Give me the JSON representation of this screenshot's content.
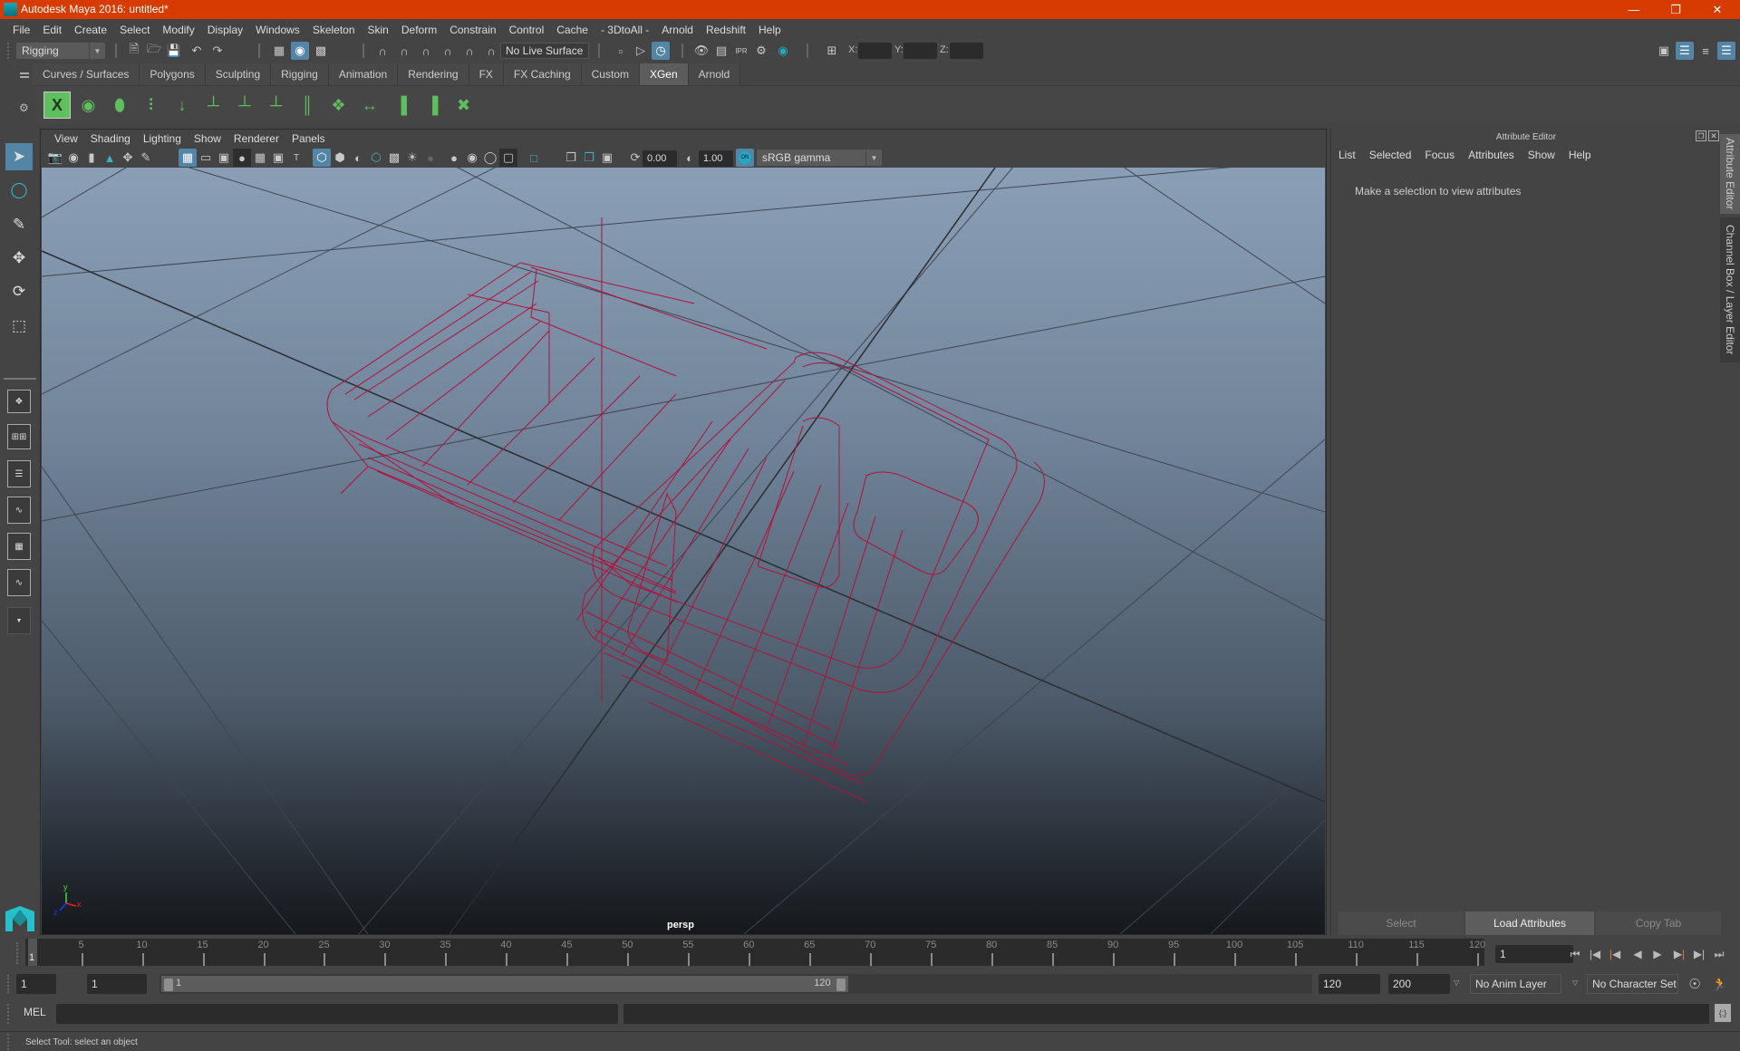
{
  "window": {
    "title": "Autodesk Maya 2016: untitled*",
    "controls": [
      "minimize",
      "restore",
      "close"
    ]
  },
  "menubar": [
    "File",
    "Edit",
    "Create",
    "Select",
    "Modify",
    "Display",
    "Windows",
    "Skeleton",
    "Skin",
    "Deform",
    "Constrain",
    "Control",
    "Cache",
    "- 3DtoAll -",
    "Arnold",
    "Redshift",
    "Help"
  ],
  "statusline": {
    "menu_set": "Rigging",
    "live_surface": "No Live Surface",
    "x_label": "X:",
    "y_label": "Y:",
    "z_label": "Z:",
    "x_value": "",
    "y_value": "",
    "z_value": ""
  },
  "shelf": {
    "tabs": [
      "Curves / Surfaces",
      "Polygons",
      "Sculpting",
      "Rigging",
      "Animation",
      "Rendering",
      "FX",
      "FX Caching",
      "Custom",
      "XGen",
      "Arnold"
    ],
    "active_tab": "XGen",
    "icons": [
      "xgen-editor",
      "preview-toggle",
      "create-description",
      "add-guides",
      "place-guides",
      "add-guide",
      "sculpt-guide",
      "lock-guide",
      "guide-curves",
      "create-patches",
      "rebuild-guides",
      "select-guides",
      "guide-bounds",
      "delete-guides"
    ]
  },
  "viewport": {
    "menu": [
      "View",
      "Shading",
      "Lighting",
      "Show",
      "Renderer",
      "Panels"
    ],
    "exposure": "0.00",
    "gamma": "1.00",
    "color_management": "ON",
    "view_transform": "sRGB gamma",
    "camera": "persp",
    "axis_labels": {
      "x": "x",
      "y": "y",
      "z": "z"
    }
  },
  "attribute_editor": {
    "title": "Attribute Editor",
    "menu": [
      "List",
      "Selected",
      "Focus",
      "Attributes",
      "Show",
      "Help"
    ],
    "message": "Make a selection to view attributes",
    "buttons": [
      "Select",
      "Load Attributes",
      "Copy Tab"
    ]
  },
  "side_tabs": [
    "Attribute Editor",
    "Channel Box / Layer Editor"
  ],
  "timeline": {
    "ticks": [
      5,
      10,
      15,
      20,
      25,
      30,
      35,
      40,
      45,
      50,
      55,
      60,
      65,
      70,
      75,
      80,
      85,
      90,
      95,
      100,
      105,
      110,
      115,
      120
    ],
    "start": 1,
    "end": 120,
    "current_frame": "1",
    "cursor_label": "1"
  },
  "range": {
    "start_time": "1",
    "playback_start": "1",
    "slider_start": "1",
    "slider_end": "120",
    "playback_end": "120",
    "end_time": "200",
    "anim_layer": "No Anim Layer",
    "character_set": "No Character Set"
  },
  "command_line": {
    "label": "MEL",
    "value": ""
  },
  "help_line": "Select Tool: select an object"
}
